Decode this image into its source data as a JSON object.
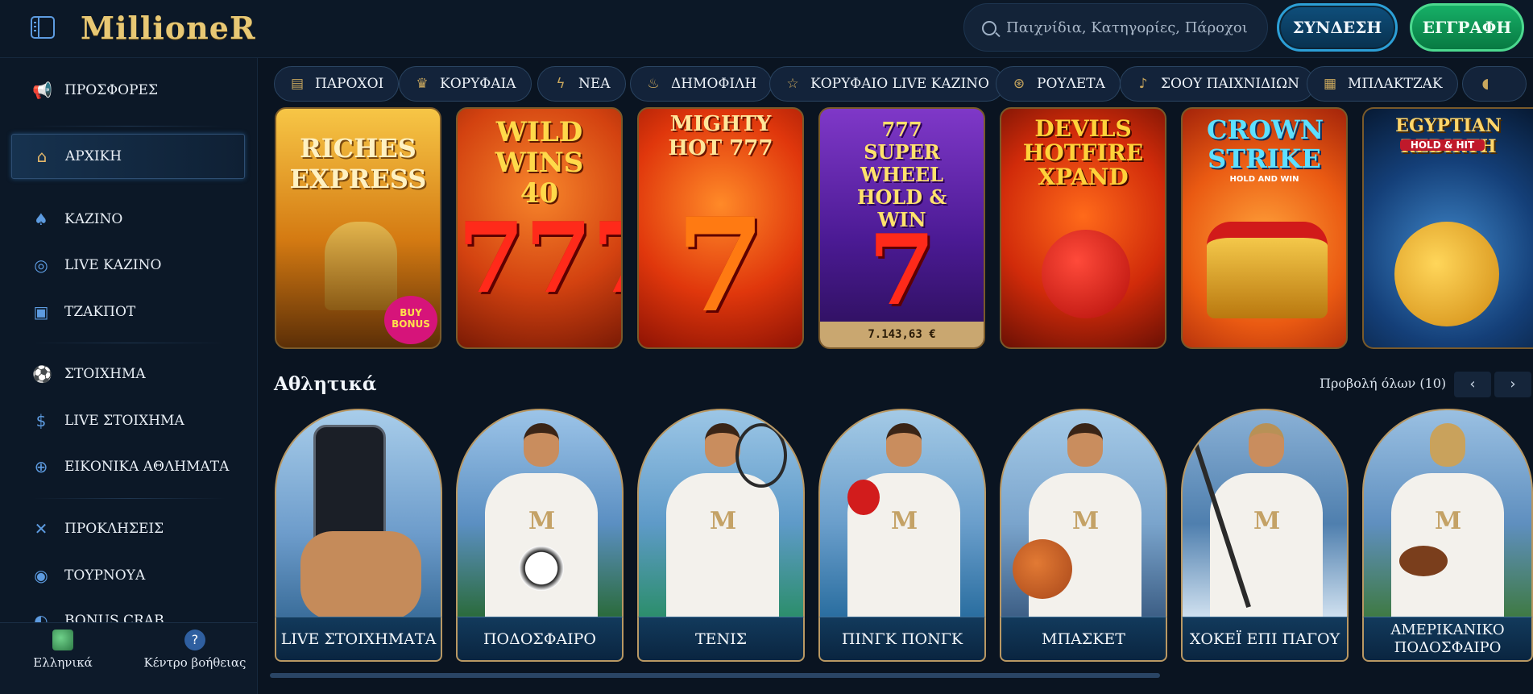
{
  "header": {
    "logo_text": "MillioneR",
    "search_placeholder": "Παιχνίδια, Κατηγορίες, Πάροχοι",
    "login_label": "ΣΥΝΔΕΣΗ",
    "register_label": "ΕΓΓΡΑΦΗ"
  },
  "sidebar": {
    "items": [
      {
        "label": "ΠΡΟΣΦΟΡΕΣ",
        "icon": "megaphone-icon"
      },
      {
        "label": "ΑΡΧΙΚΗ",
        "icon": "home-icon"
      },
      {
        "label": "ΚΑΖΙΝΟ",
        "icon": "spade-icon"
      },
      {
        "label": "LIVE ΚΑΖΙΝΟ",
        "icon": "roulette-icon"
      },
      {
        "label": "ΤΖΑΚΠΟΤ",
        "icon": "jackpot-icon"
      },
      {
        "label": "ΣΤΟΙΧΗΜΑ",
        "icon": "soccer-ball-icon"
      },
      {
        "label": "LIVE ΣΤΟΙΧΗΜΑ",
        "icon": "dollar-coin-icon"
      },
      {
        "label": "ΕΙΚΟΝΙΚΑ ΑΘΛΗΜΑΤΑ",
        "icon": "virtual-sports-icon"
      },
      {
        "label": "ΠΡΟΚΛΗΣΕΙΣ",
        "icon": "challenges-icon"
      },
      {
        "label": "ΤΟΥΡΝΟΥΑ",
        "icon": "medal-icon"
      },
      {
        "label": "BONUS CRAB",
        "icon": "crab-icon"
      }
    ],
    "footer": {
      "language_label": "Ελληνικά",
      "help_label": "Κέντρο βοήθειας"
    }
  },
  "categories": [
    {
      "label": "ΠΑΡΟΧΟΙ",
      "icon": "providers-icon"
    },
    {
      "label": "ΚΟΡΥΦΑΙΑ",
      "icon": "crown-icon"
    },
    {
      "label": "ΝΕΑ",
      "icon": "lightning-icon"
    },
    {
      "label": "ΔΗΜΟΦΙΛΗ",
      "icon": "flame-icon"
    },
    {
      "label": "ΚΟΡΥΦΑΙΟ LIVE ΚΑΖΙΝΟ",
      "icon": "star-icon"
    },
    {
      "label": "ΡΟΥΛΕΤΑ",
      "icon": "roulette-icon"
    },
    {
      "label": "ΣΟΟΥ ΠΑΙΧΝΙΔΙΩΝ",
      "icon": "microphone-icon"
    },
    {
      "label": "ΜΠΛΑΚΤΖΑΚ",
      "icon": "cards-icon"
    }
  ],
  "games": [
    {
      "title": "RICHES EXPRESS",
      "badge": "BUY BONUS",
      "colors": [
        "#f6b32c",
        "#7a3b07"
      ]
    },
    {
      "title": "WILD WINS 40",
      "colors": [
        "#e44a10",
        "#7c1604"
      ]
    },
    {
      "title": "MIGHTY HOT 777",
      "colors": [
        "#f25a12",
        "#a81606"
      ]
    },
    {
      "title": "777 SUPER WHEEL HOLD & WIN",
      "jackpot": "7.143,63 €",
      "colors": [
        "#6b2bb5",
        "#2a0f57"
      ]
    },
    {
      "title": "DEVILS HOTFIRE XPAND",
      "colors": [
        "#ef5c12",
        "#7a1305"
      ]
    },
    {
      "title": "CROWN STRIKE",
      "subtitle": "HOLD AND WIN",
      "colors": [
        "#f07a16",
        "#b42a08"
      ]
    },
    {
      "title": "EGYPTIAN REBIRTH",
      "subtitle": "HOLD & HIT",
      "colors": [
        "#1b5c9a",
        "#08203e"
      ]
    }
  ],
  "sports_section": {
    "title": "Αθλητικά",
    "view_all": "Προβολή όλων (10)",
    "items": [
      {
        "label": "LIVE ΣΤΟΙΧΗΜΑΤΑ"
      },
      {
        "label": "ΠΟΔΟΣΦΑΙΡΟ"
      },
      {
        "label": "ΤΕΝΙΣ"
      },
      {
        "label": "ΠΙΝΓΚ ΠΟΝΓΚ"
      },
      {
        "label": "ΜΠΑΣΚΕΤ"
      },
      {
        "label": "ΧΟΚΕΪ ΕΠΙ ΠΑΓΟΥ"
      },
      {
        "label": "ΑΜΕΡΙΚΑΝΙΚΟ ΠΟΔΟΣΦΑΙΡΟ"
      }
    ]
  },
  "colors": {
    "accent_blue": "#2c9fd6",
    "accent_green": "#16b067",
    "gold": "#b99863",
    "background": "#0a1421"
  }
}
